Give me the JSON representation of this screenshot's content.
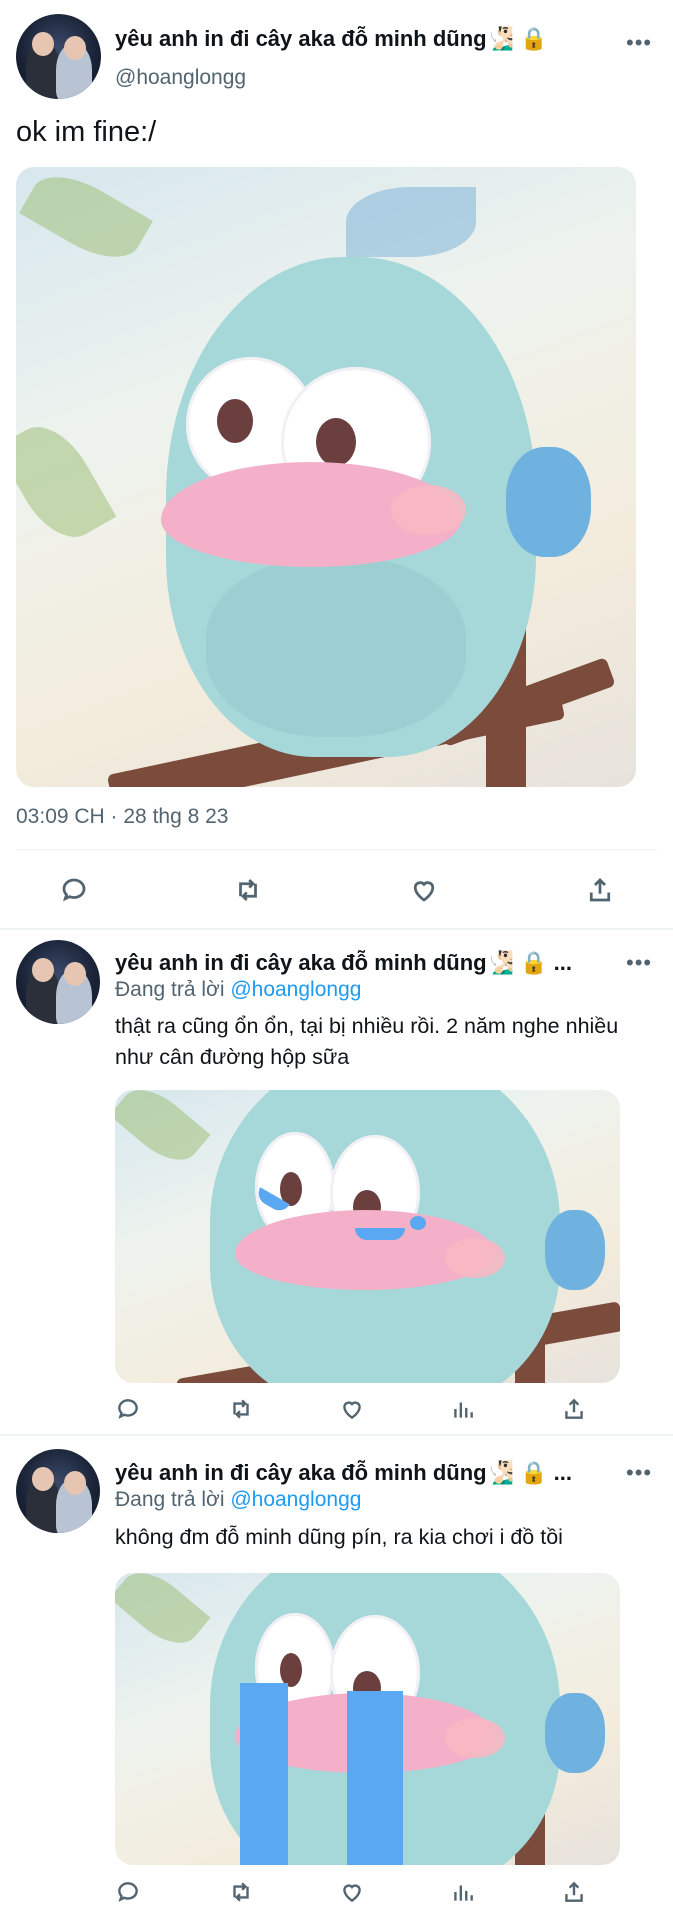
{
  "main_tweet": {
    "author_name": "yêu anh in đi cây aka đỗ minh dũng🧏🏻‍♂️ 🔒",
    "handle": "@hoanglongg",
    "more": "•••",
    "text": "ok im fine:/",
    "timestamp": "03:09 CH · 28 thg 8 23",
    "actions": [
      "reply-icon",
      "retweet-icon",
      "like-icon",
      "share-icon"
    ]
  },
  "replies": [
    {
      "author_name": "yêu anh in đi cây aka đỗ minh dũng🧏🏻‍♂️ 🔒 ...",
      "replying_prefix": "Đang trả lời ",
      "replying_to": "@hoanglongg",
      "more": "•••",
      "text": "thật ra cũng ổn ổn, tại bị nhiều rồi. 2 năm nghe nhiều như cân đường hộp sữa",
      "actions": [
        "reply-icon",
        "retweet-icon",
        "like-icon",
        "views-icon",
        "share-icon"
      ]
    },
    {
      "author_name": "yêu anh in đi cây aka đỗ minh dũng🧏🏻‍♂️ 🔒 ...",
      "replying_prefix": "Đang trả lời ",
      "replying_to": "@hoanglongg",
      "more": "•••",
      "text": "không đm đỗ minh dũng pín, ra kia chơi i đồ tồi",
      "actions": [
        "reply-icon",
        "retweet-icon",
        "like-icon",
        "views-icon",
        "share-icon"
      ]
    }
  ],
  "colors": {
    "text": "#0f1419",
    "secondary": "#536471",
    "link": "#1d9bf0",
    "divider": "#eff3f4"
  }
}
